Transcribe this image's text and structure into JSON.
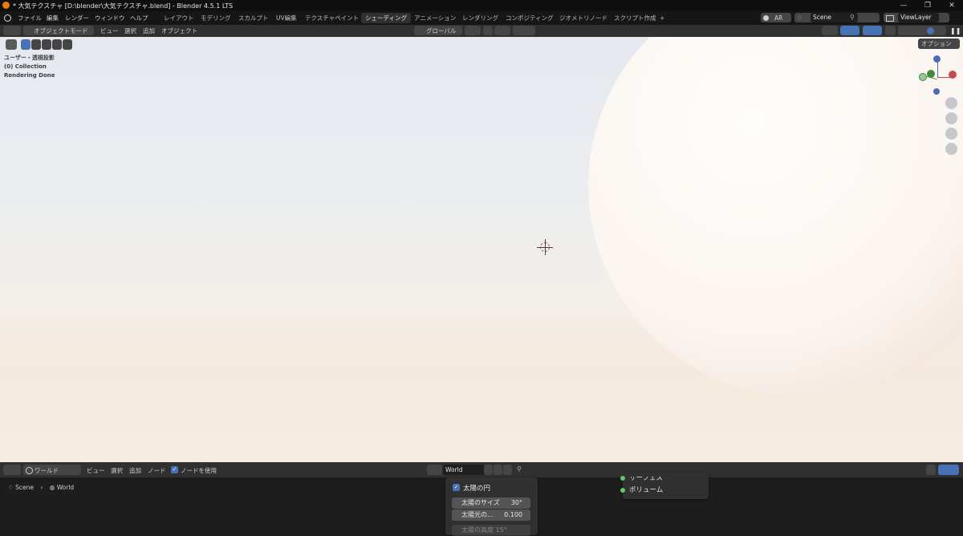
{
  "window": {
    "title": "* 大気テクスチャ [D:\\blender\\大気テクスチャ.blend] - Blender 4.5.1 LTS",
    "controls": [
      "—",
      "❐",
      "✕"
    ]
  },
  "menubar": {
    "menus": [
      "ファイル",
      "編集",
      "レンダー",
      "ウィンドウ",
      "ヘルプ"
    ],
    "workspaces": [
      "レイアウト",
      "モデリング",
      "スカルプト",
      "UV編集",
      "テクスチャペイント",
      "シェーディング",
      "アニメーション",
      "レンダリング",
      "コンポジティング",
      "ジオメトリノード",
      "スクリプト作成"
    ],
    "active_workspace": "シェーディング",
    "add_tab": "+",
    "ar_label": "AR",
    "scene": "Scene",
    "view_layer": "ViewLayer"
  },
  "viewport_header": {
    "mode": "オブジェクトモード",
    "menus": [
      "ビュー",
      "選択",
      "追加",
      "オブジェクト"
    ],
    "orientation": "グローバル",
    "options": "オプション"
  },
  "viewport_overlay": {
    "lines": [
      "ユーザー・透視投影",
      "(0) Collection",
      "Rendering Done"
    ]
  },
  "node_header": {
    "world_type": "ワールド",
    "menus": [
      "ビュー",
      "選択",
      "追加",
      "ノード"
    ],
    "use_nodes": "ノードを使用",
    "datablock": "World"
  },
  "breadcrumb": {
    "scene": "Scene",
    "world": "World"
  },
  "sky_node": {
    "sun_disc": "太陽の円",
    "sun_size_label": "太陽のサイズ",
    "sun_size_value": "30°",
    "sun_intensity_label": "太陽光の...",
    "sun_intensity_value": "0.100",
    "partial_row": "太陽の高度   15°"
  },
  "output_node": {
    "surface": "サーフェス",
    "volume": "ボリューム"
  }
}
